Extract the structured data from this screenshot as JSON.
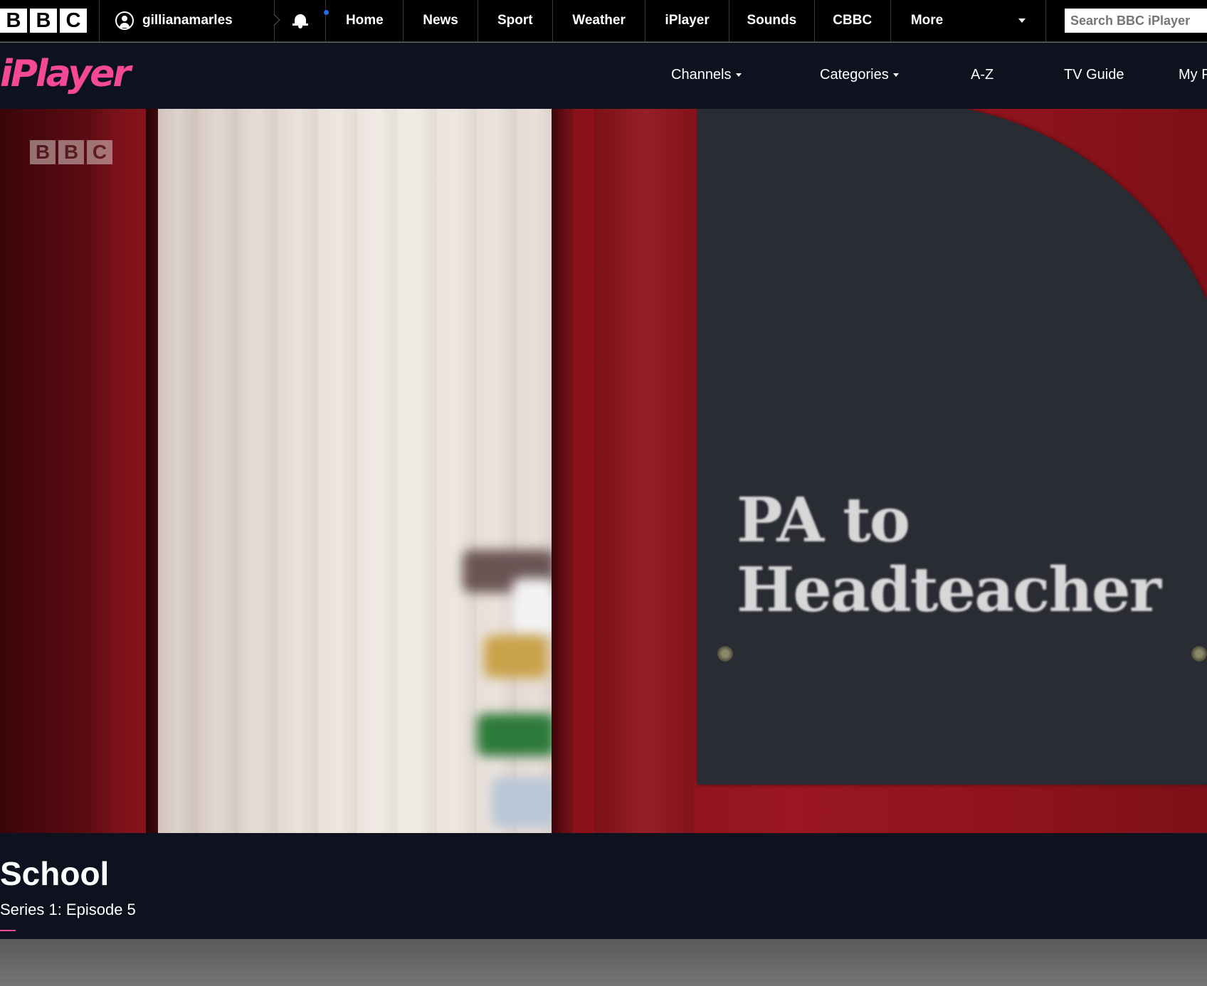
{
  "global_nav": {
    "logo_letters": [
      "B",
      "B",
      "C"
    ],
    "username": "gillianamarles",
    "items": [
      "Home",
      "News",
      "Sport",
      "Weather",
      "iPlayer",
      "Sounds",
      "CBBC"
    ],
    "more_label": "More",
    "search_placeholder": "Search BBC iPlayer"
  },
  "iplayer_nav": {
    "logo_text": "iPlayer",
    "channels_label": "Channels",
    "categories_label": "Categories",
    "az_label": "A-Z",
    "tvguide_label": "TV Guide",
    "my_label": "My Programmes"
  },
  "video": {
    "watermark_letters": [
      "B",
      "B",
      "C"
    ],
    "sign_line1": "PA to",
    "sign_line2": "Headteacher"
  },
  "programme": {
    "title": "School",
    "episode": "Series 1: Episode 5"
  },
  "colors": {
    "iplayer_pink": "#f54997",
    "nav_background": "#0e121f",
    "notification_dot": "#1a73e8"
  },
  "icons": {
    "account": "account-icon",
    "notifications": "bell-icon",
    "more_caret": "chevron-down-icon"
  }
}
